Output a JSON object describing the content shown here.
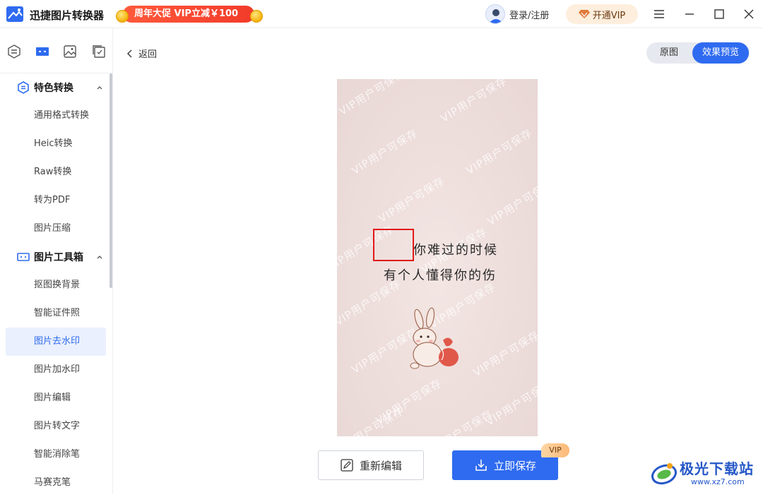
{
  "app": {
    "title": "迅捷图片转换器",
    "promo": "周年大促 VIP立减￥100",
    "login": "登录/注册",
    "vip_button": "开通VIP"
  },
  "colors": {
    "accent": "#2f6bf0",
    "promo_red": "#f23b2a",
    "selection_red": "#e11919"
  },
  "sidebar": {
    "groups": [
      {
        "label": "特色转换",
        "icon": "convert-icon",
        "items": [
          "通用格式转换",
          "Heic转换",
          "Raw转换",
          "转为PDF",
          "图片压缩"
        ]
      },
      {
        "label": "图片工具箱",
        "icon": "toolbox-icon",
        "items": [
          "抠图换背景",
          "智能证件照",
          "图片去水印",
          "图片加水印",
          "图片编辑",
          "图片转文字",
          "智能消除笔",
          "马赛克笔"
        ]
      }
    ],
    "active_item": "图片去水印"
  },
  "main": {
    "back_label": "返回",
    "toggle": {
      "original": "原图",
      "preview": "效果预览",
      "selected": "效果预览"
    },
    "image": {
      "watermark": "VIP用户可保存",
      "line1": "你难过的时候",
      "line2": "有个人懂得你的伤"
    }
  },
  "actions": {
    "reedit": "重新编辑",
    "save": "立即保存",
    "vip_badge": "VIP"
  },
  "brand": {
    "name": "极光下载站",
    "url": "www.xz7.com"
  }
}
